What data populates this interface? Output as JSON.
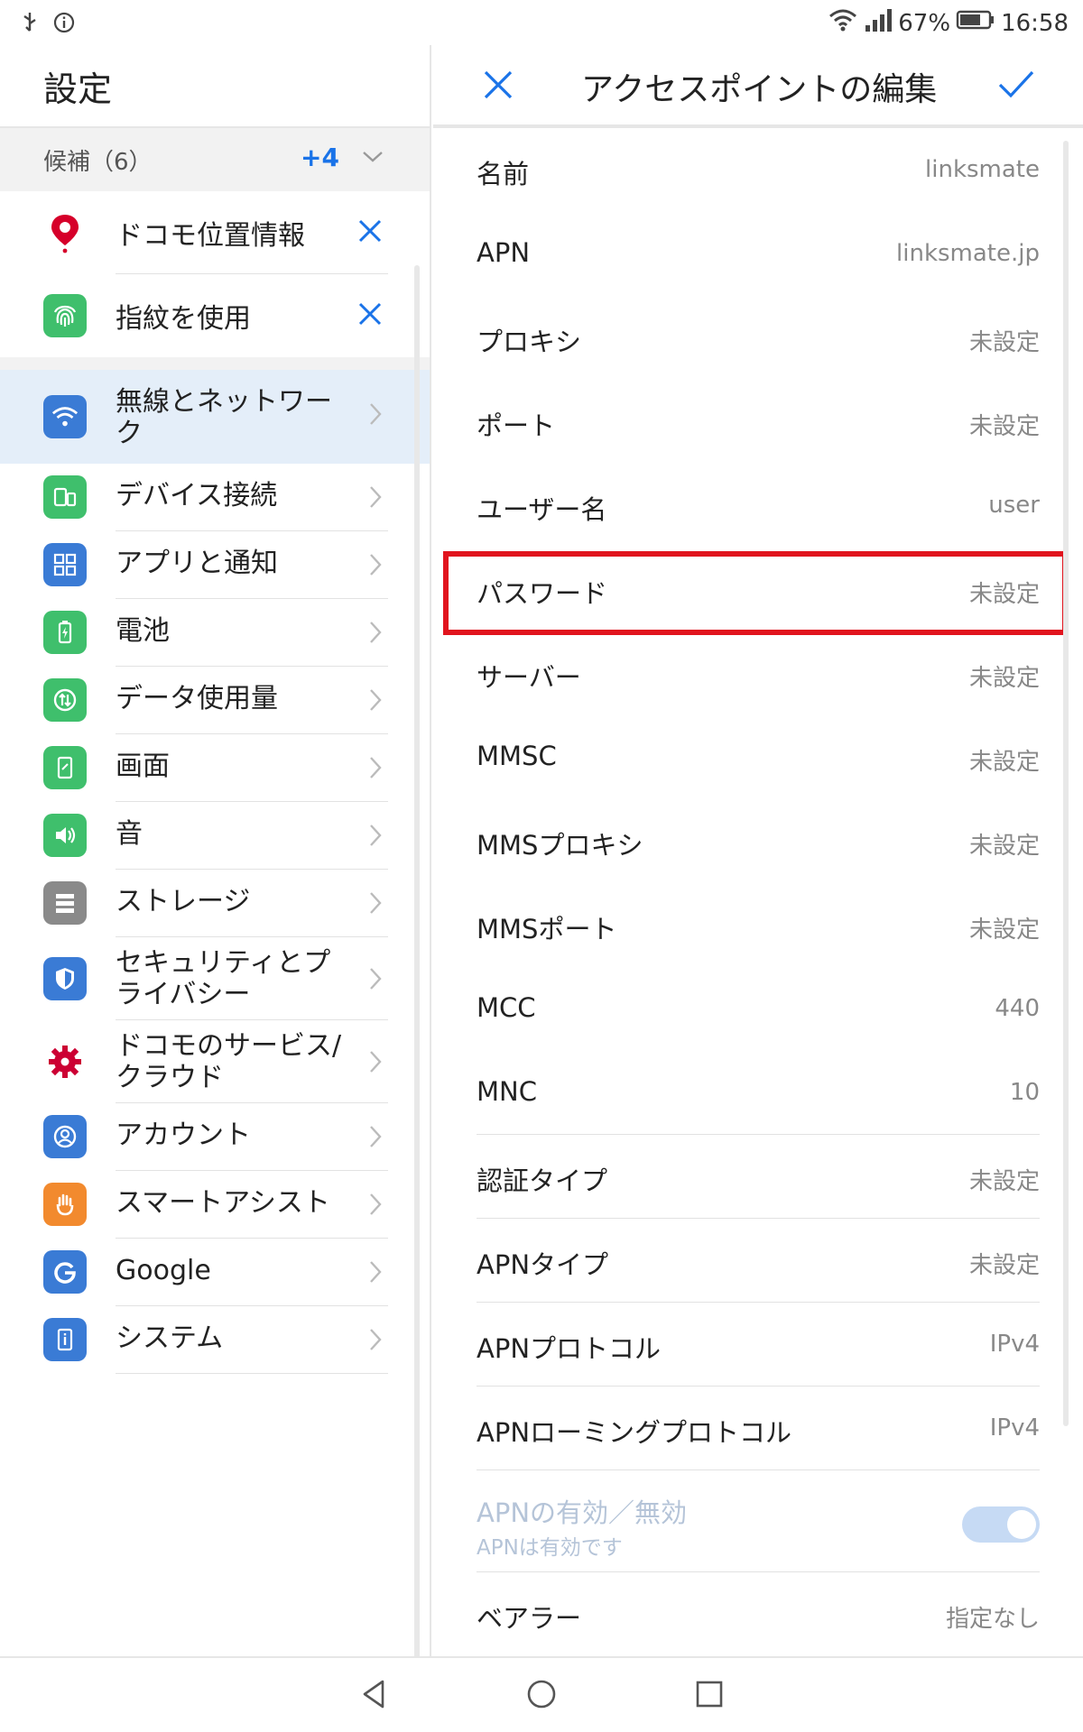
{
  "statusbar": {
    "battery": "67%",
    "time": "16:58",
    "icons": [
      "usb-icon",
      "info-icon",
      "wifi-icon",
      "signal-icon",
      "battery-icon"
    ]
  },
  "left": {
    "title": "設定",
    "suggestions": {
      "label": "候補（6）",
      "more": "+4",
      "items": [
        {
          "label": "ドコモ位置情報",
          "icon": "location-pin-icon"
        },
        {
          "label": "指紋を使用",
          "icon": "fingerprint-icon"
        }
      ]
    },
    "items": [
      {
        "label": "無線とネットワーク",
        "icon": "wifi-icon",
        "color": "#3a7bd5"
      },
      {
        "label": "デバイス接続",
        "icon": "device-connection-icon",
        "color": "#3fbf6c"
      },
      {
        "label": "アプリと通知",
        "icon": "apps-icon",
        "color": "#3a7bd5"
      },
      {
        "label": "電池",
        "icon": "battery-icon",
        "color": "#3fbf6c"
      },
      {
        "label": "データ使用量",
        "icon": "data-usage-icon",
        "color": "#3fbf6c"
      },
      {
        "label": "画面",
        "icon": "display-icon",
        "color": "#3fbf6c"
      },
      {
        "label": "音",
        "icon": "sound-icon",
        "color": "#3fbf6c"
      },
      {
        "label": "ストレージ",
        "icon": "storage-icon",
        "color": "#8a8a8a"
      },
      {
        "label": "セキュリティとプライバシー",
        "icon": "security-shield-icon",
        "color": "#3a7bd5"
      },
      {
        "label": "ドコモのサービス/クラウド",
        "icon": "docomo-gear-icon",
        "color": "#cc0033"
      },
      {
        "label": "アカウント",
        "icon": "account-icon",
        "color": "#3a7bd5"
      },
      {
        "label": "スマートアシスト",
        "icon": "smart-assist-hand-icon",
        "color": "#f28a2e"
      },
      {
        "label": "Google",
        "icon": "google-icon",
        "color": "#3a7bd5"
      },
      {
        "label": "システム",
        "icon": "system-info-icon",
        "color": "#3a7bd5"
      }
    ]
  },
  "right": {
    "title": "アクセスポイントの編集",
    "rows": [
      {
        "label": "名前",
        "value": "linksmate"
      },
      {
        "label": "APN",
        "value": "linksmate.jp"
      },
      {
        "label": "プロキシ",
        "value": "未設定"
      },
      {
        "label": "ポート",
        "value": "未設定"
      },
      {
        "label": "ユーザー名",
        "value": "user"
      },
      {
        "label": "パスワード",
        "value": "未設定"
      },
      {
        "label": "サーバー",
        "value": "未設定"
      },
      {
        "label": "MMSC",
        "value": "未設定"
      },
      {
        "label": "MMSプロキシ",
        "value": "未設定"
      },
      {
        "label": "MMSポート",
        "value": "未設定"
      },
      {
        "label": "MCC",
        "value": "440"
      },
      {
        "label": "MNC",
        "value": "10"
      },
      {
        "label": "認証タイプ",
        "value": "未設定"
      },
      {
        "label": "APNタイプ",
        "value": "未設定"
      },
      {
        "label": "APNプロトコル",
        "value": "IPv4"
      },
      {
        "label": "APNローミングプロトコル",
        "value": "IPv4"
      }
    ],
    "toggle": {
      "title": "APNの有効／無効",
      "subtitle": "APNは有効です",
      "on": true
    },
    "bearer": {
      "label": "ベアラー",
      "value": "指定なし"
    },
    "highlighted_row": "パスワード"
  },
  "navbar": {
    "buttons": [
      "back-icon",
      "home-icon",
      "recents-icon"
    ]
  }
}
